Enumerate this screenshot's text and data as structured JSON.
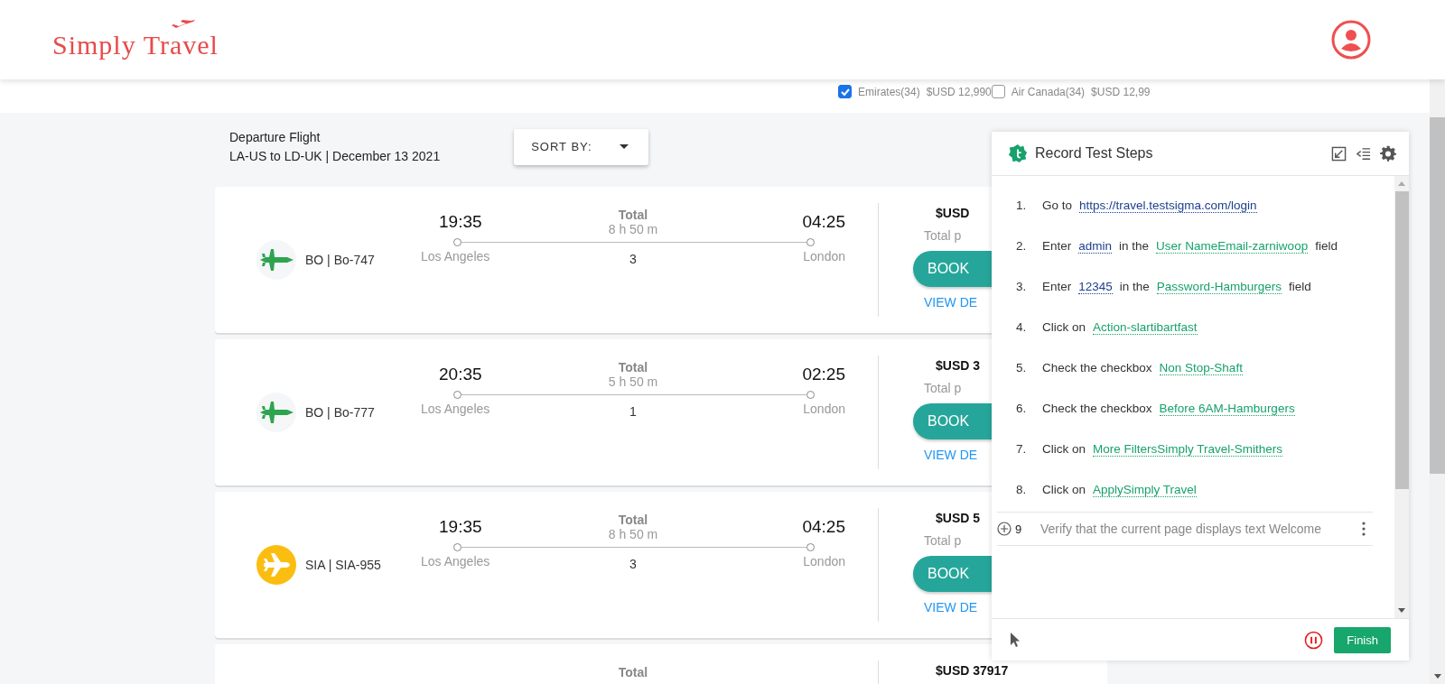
{
  "header": {
    "logo": "Simply Travel"
  },
  "filters": [
    {
      "label": "Emirates(34)",
      "price": "$USD 12,990",
      "checked": true
    },
    {
      "label": "Air Canada(34)",
      "price": "$USD 12,99",
      "checked": false
    }
  ],
  "results": {
    "title": "Departure Flight",
    "route": "LA-US to LD-UK | December 13 2021",
    "sort": "SORT BY:"
  },
  "flights": [
    {
      "airline": "BO | Bo-747",
      "kind": "jet",
      "dep_time": "19:35",
      "dep_city": "Los Angeles",
      "total": "Total",
      "duration": "8 h 50 m",
      "stops": "3",
      "arr_time": "04:25",
      "arr_city": "London",
      "price": "$USD",
      "price_note": "Total p",
      "book": "BOOK",
      "details": "VIEW DE"
    },
    {
      "airline": "BO | Bo-777",
      "kind": "jet",
      "dep_time": "20:35",
      "dep_city": "Los Angeles",
      "total": "Total",
      "duration": "5 h 50 m",
      "stops": "1",
      "arr_time": "02:25",
      "arr_city": "London",
      "price": "$USD 3",
      "price_note": "Total p",
      "book": "BOOK",
      "details": "VIEW DE"
    },
    {
      "airline": "SIA | SIA-955",
      "kind": "plane",
      "dep_time": "19:35",
      "dep_city": "Los Angeles",
      "total": "Total",
      "duration": "8 h 50 m",
      "stops": "3",
      "arr_time": "04:25",
      "arr_city": "London",
      "price": "$USD 5",
      "price_note": "Total p",
      "book": "BOOK",
      "details": "VIEW DE"
    },
    {
      "total": "Total",
      "price": "$USD 37917"
    }
  ],
  "recorder": {
    "title": "Record Test Steps",
    "steps": [
      {
        "number": "1.",
        "parts": [
          {
            "kind": "text",
            "text": "Go to"
          },
          {
            "kind": "value",
            "text": "https://travel.testsigma.com/login"
          }
        ]
      },
      {
        "number": "2.",
        "parts": [
          {
            "kind": "text",
            "text": "Enter"
          },
          {
            "kind": "value",
            "text": "admin"
          },
          {
            "kind": "text",
            "text": "in the"
          },
          {
            "kind": "element",
            "text": "User NameEmail-zarniwoop"
          },
          {
            "kind": "text",
            "text": "field"
          }
        ]
      },
      {
        "number": "3.",
        "parts": [
          {
            "kind": "text",
            "text": "Enter"
          },
          {
            "kind": "value",
            "text": "12345"
          },
          {
            "kind": "text",
            "text": "in the"
          },
          {
            "kind": "element",
            "text": "Password-Hamburgers"
          },
          {
            "kind": "text",
            "text": "field"
          }
        ]
      },
      {
        "number": "4.",
        "parts": [
          {
            "kind": "text",
            "text": "Click on"
          },
          {
            "kind": "element",
            "text": "Action-slartibartfast"
          }
        ]
      },
      {
        "number": "5.",
        "parts": [
          {
            "kind": "text",
            "text": "Check the checkbox"
          },
          {
            "kind": "element",
            "text": "Non Stop-Shaft"
          }
        ]
      },
      {
        "number": "6.",
        "parts": [
          {
            "kind": "text",
            "text": "Check the checkbox"
          },
          {
            "kind": "element",
            "text": "Before 6AM-Hamburgers"
          }
        ]
      },
      {
        "number": "7.",
        "parts": [
          {
            "kind": "text",
            "text": "Click on"
          },
          {
            "kind": "element",
            "text": "More FiltersSimply Travel-Smithers"
          }
        ]
      },
      {
        "number": "8.",
        "parts": [
          {
            "kind": "text",
            "text": "Click on"
          },
          {
            "kind": "element",
            "text": "ApplySimply Travel"
          }
        ]
      }
    ],
    "next_step": {
      "number": "9",
      "text": "Verify that the current page displays text Welcome"
    },
    "finish": "Finish"
  }
}
